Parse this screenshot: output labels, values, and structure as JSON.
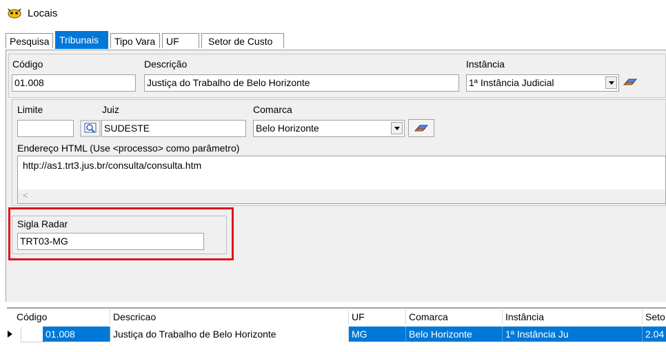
{
  "window": {
    "title": "Locais"
  },
  "tabs": [
    "Pesquisa",
    "Tribunais",
    "Tipo Vara",
    "UF",
    "Setor de Custo"
  ],
  "active_tab": "Tribunais",
  "form": {
    "codigo_label": "Código",
    "codigo_value": "01.008",
    "descricao_label": "Descrição",
    "descricao_value": "Justiça do Trabalho de Belo Horizonte",
    "instancia_label": "Instância",
    "instancia_value": "1ª Instância Judicial",
    "limite_label": "Limite",
    "limite_value": "",
    "juiz_label": "Juiz",
    "juiz_value": "SUDESTE",
    "comarca_label": "Comarca",
    "comarca_value": "Belo Horizonte",
    "endereco_label": "Endereço HTML (Use <processo> como parâmetro)",
    "endereco_value": "http://as1.trt3.jus.br/consulta/consulta.htm",
    "sigla_label": "Sigla Radar",
    "sigla_value": "TRT03-MG"
  },
  "grid": {
    "columns": [
      "Código",
      "Descricao",
      "UF",
      "Comarca",
      "Instância",
      "Seto"
    ],
    "rows": [
      {
        "codigo": "01.008",
        "descricao": "Justiça do Trabalho de Belo Horizonte",
        "uf": "MG",
        "comarca": "Belo Horizonte",
        "instancia": "1ª Instância Ju",
        "setor": "2.04"
      }
    ]
  },
  "colors": {
    "accent": "#0078d7",
    "highlight": "#e0121b",
    "panel": "#f0f0f0"
  }
}
